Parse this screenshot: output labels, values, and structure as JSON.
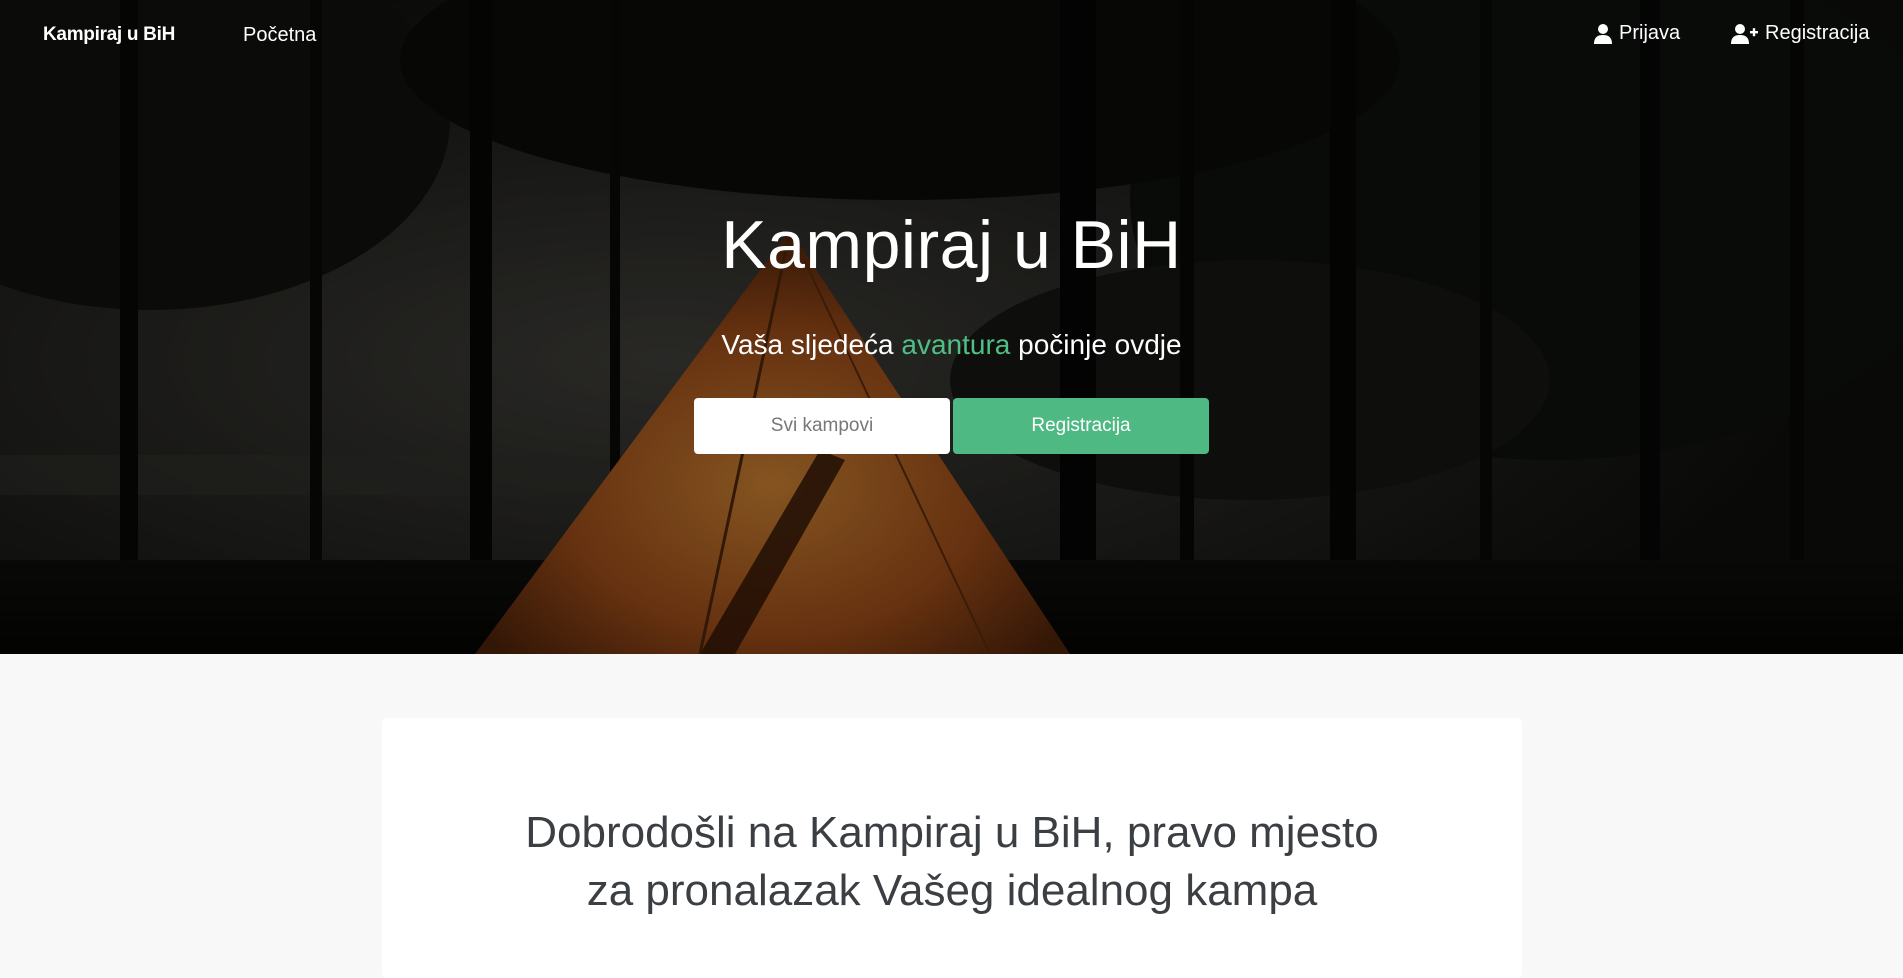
{
  "navbar": {
    "brand": "Kampiraj u BiH",
    "home": "Početna",
    "login": "Prijava",
    "register": "Registracija",
    "login_icon": "user-icon",
    "register_icon": "user-plus-icon"
  },
  "hero": {
    "title": "Kampiraj u BiH",
    "subtitle_before": "Vaša sljedeća ",
    "subtitle_accent": "avantura",
    "subtitle_after": " počinje ovdje",
    "all_camps_button": "Svi kampovi",
    "register_button": "Registracija"
  },
  "welcome": {
    "line1": "Dobrodošli na Kampiraj u BiH, pravo mjesto",
    "line2": "za pronalazak Vašeg idealnog kampa"
  },
  "colors": {
    "accent": "#4fb983",
    "hero_overlay": "#000000",
    "page_background": "#f8f8f8"
  }
}
